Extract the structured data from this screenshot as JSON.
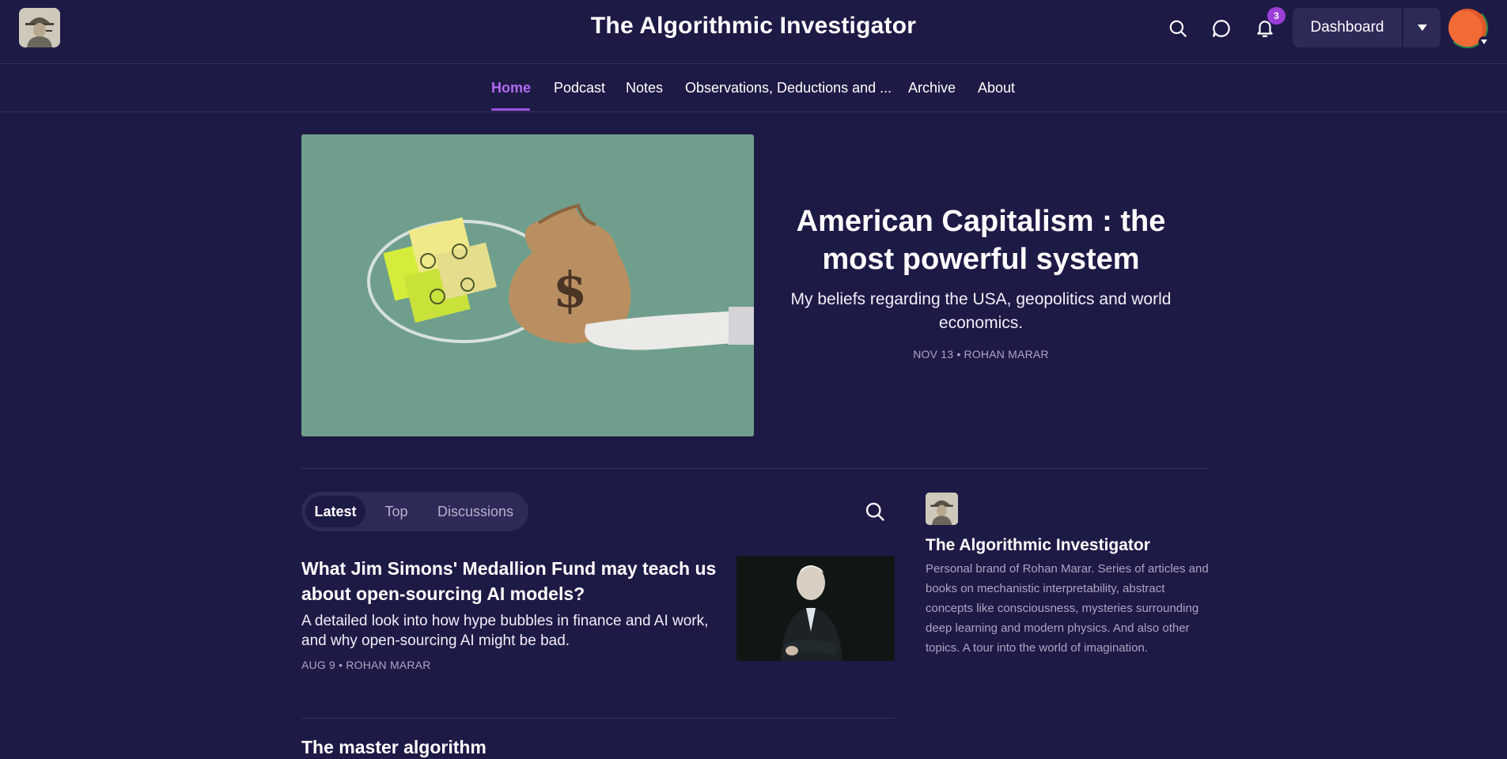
{
  "header": {
    "site_title": "The Algorithmic Investigator",
    "logo_icon": "detective-avatar-icon",
    "notification_count": "3",
    "dashboard_label": "Dashboard",
    "icons": [
      "search-icon",
      "chat-icon",
      "bell-icon",
      "caret-down-icon",
      "user-avatar"
    ],
    "colors": {
      "background": "#1e1a46",
      "accent": "#9b3fd6",
      "button": "#2d2a58"
    }
  },
  "nav": {
    "items": [
      {
        "label": "Home",
        "active": true
      },
      {
        "label": "Podcast"
      },
      {
        "label": "Notes"
      },
      {
        "label": "Observations, Deductions and ..."
      },
      {
        "label": "Archive"
      },
      {
        "label": "About"
      }
    ]
  },
  "hero": {
    "title": "American Capitalism : the most powerful system",
    "subtitle": "My beliefs regarding the USA, geopolitics and world economics.",
    "meta": "NOV 13 • ROHAN MARAR",
    "image": "money-bag-ideas-illustration"
  },
  "feed": {
    "tabs": [
      {
        "label": "Latest",
        "active": true
      },
      {
        "label": "Top"
      },
      {
        "label": "Discussions"
      }
    ],
    "posts": [
      {
        "title": "What Jim Simons' Medallion Fund may teach us about open-sourcing AI models?",
        "description": "A detailed look into how hype bubbles in finance and AI work, and why open-sourcing AI might be bad.",
        "meta": "AUG 9 • ROHAN MARAR",
        "thumbnail": "portrait-photo"
      },
      {
        "title": "The master algorithm"
      }
    ]
  },
  "sidebar": {
    "title": "The Algorithmic Investigator",
    "description": "Personal brand of Rohan Marar. Series of articles and books on mechanistic interpretability, abstract concepts like consciousness, mysteries surrounding deep learning and modern physics. And also other topics. A tour into the world of imagination."
  }
}
